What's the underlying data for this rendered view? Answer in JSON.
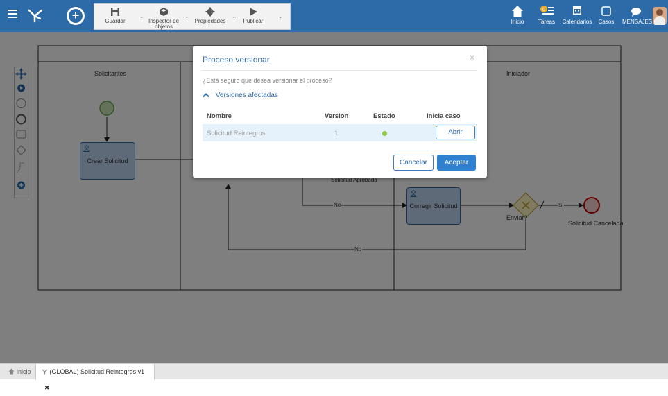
{
  "toolbar": {
    "save_label": "Guardar",
    "inspector_label_1": "Inspector de",
    "inspector_label_2": "objetos",
    "properties_label": "Propiedades",
    "publish_label": "Publicar"
  },
  "nav": {
    "home": "Inicio",
    "tasks": "Tareas",
    "tasks_badge": "0",
    "calendars": "Calendarios",
    "cases": "Casos",
    "messages": "MENSAJES"
  },
  "diagram": {
    "lane_requesters": "Solicitantes",
    "lane_initiator": "Iniciador",
    "task_create": "Crear Solicitud",
    "task_correct": "Corregir Solicitud",
    "gateway_label": "Enviar?",
    "end_label": "Solicitud Cancelada",
    "flow_no_1": "No",
    "flow_no_2": "No",
    "flow_si": "Si",
    "flow_approved": "Solicitud Aprobada"
  },
  "modal": {
    "title": "Proceso versionar",
    "close": "×",
    "question": "¿Está seguro que desea versionar el proceso?",
    "affected_label": "Versiones afectadas",
    "columns": [
      "Nombre",
      "Versión",
      "Estado",
      "Inicia caso"
    ],
    "rows": [
      {
        "name": "Solicitud Reintegros",
        "version": "1",
        "status_color": "#8cc63f",
        "action": "Abrir"
      }
    ],
    "cancel": "Cancelar",
    "accept": "Aceptar"
  },
  "tabs": {
    "home": "Inicio",
    "process": "(GLOBAL) Solicitud Reintegros v1",
    "close": "✖"
  },
  "colors": {
    "header": "#2c6aa8",
    "accent": "#2f80cf",
    "status_green": "#8cc63f"
  }
}
